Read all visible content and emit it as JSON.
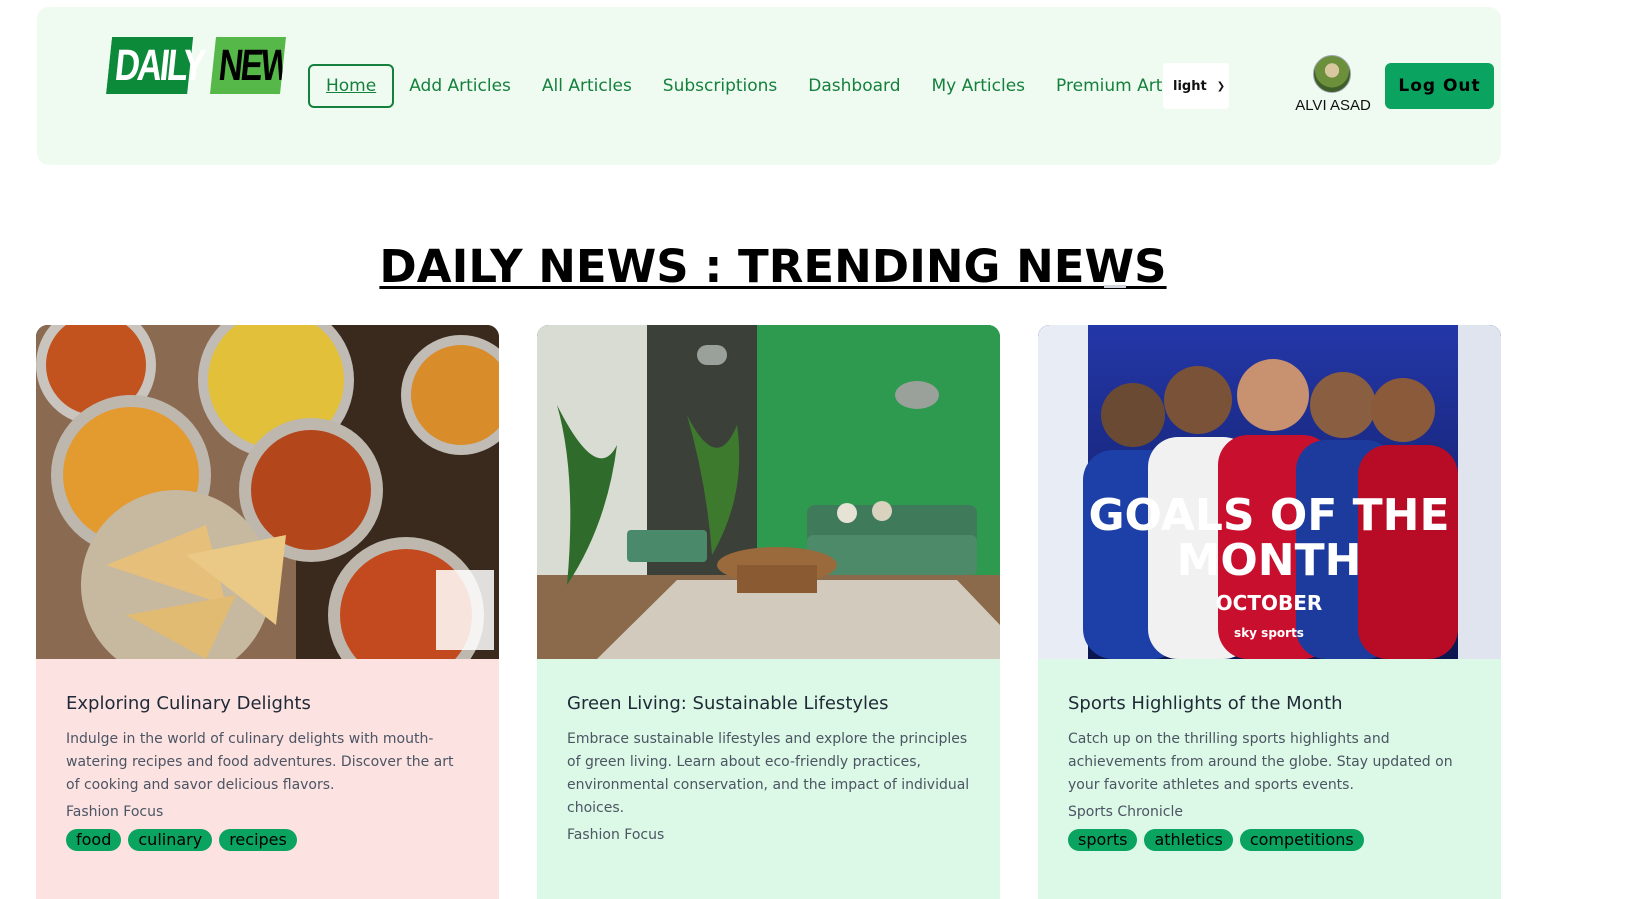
{
  "logo": {
    "part1": "DAILY",
    "part2": "NEWS"
  },
  "nav": {
    "links": [
      "Home",
      "Add Articles",
      "All Articles",
      "Subscriptions",
      "Dashboard",
      "My Articles",
      "Premium Articles"
    ],
    "theme_value": "light",
    "user_name": "ALVI ASAD",
    "logout_label": "Log Out"
  },
  "headline": "DAILY NEWS : TRENDING NEWS",
  "articles": [
    {
      "title": "Exploring Culinary Delights",
      "description": "Indulge in the world of culinary delights with mouth-watering recipes and food adventures. Discover the art of cooking and savor delicious flavors.",
      "publisher": "Fashion Focus",
      "tags": [
        "food",
        "culinary",
        "recipes"
      ]
    },
    {
      "title": "Green Living: Sustainable Lifestyles",
      "description": "Embrace sustainable lifestyles and explore the principles of green living. Learn about eco-friendly practices, environmental conservation, and the impact of individual choices.",
      "publisher": "Fashion Focus",
      "tags": []
    },
    {
      "title": "Sports Highlights of the Month",
      "description": "Catch up on the thrilling sports highlights and achievements from around the globe. Stay updated on your favorite athletes and sports events.",
      "publisher": "Sports Chronicle",
      "tags": [
        "sports",
        "athletics",
        "competitions"
      ]
    }
  ],
  "images": {
    "sports_line1": "GOALS OF THE",
    "sports_line2": "MONTH",
    "sports_line3": "OCTOBER",
    "sports_brand": "sky sports"
  }
}
